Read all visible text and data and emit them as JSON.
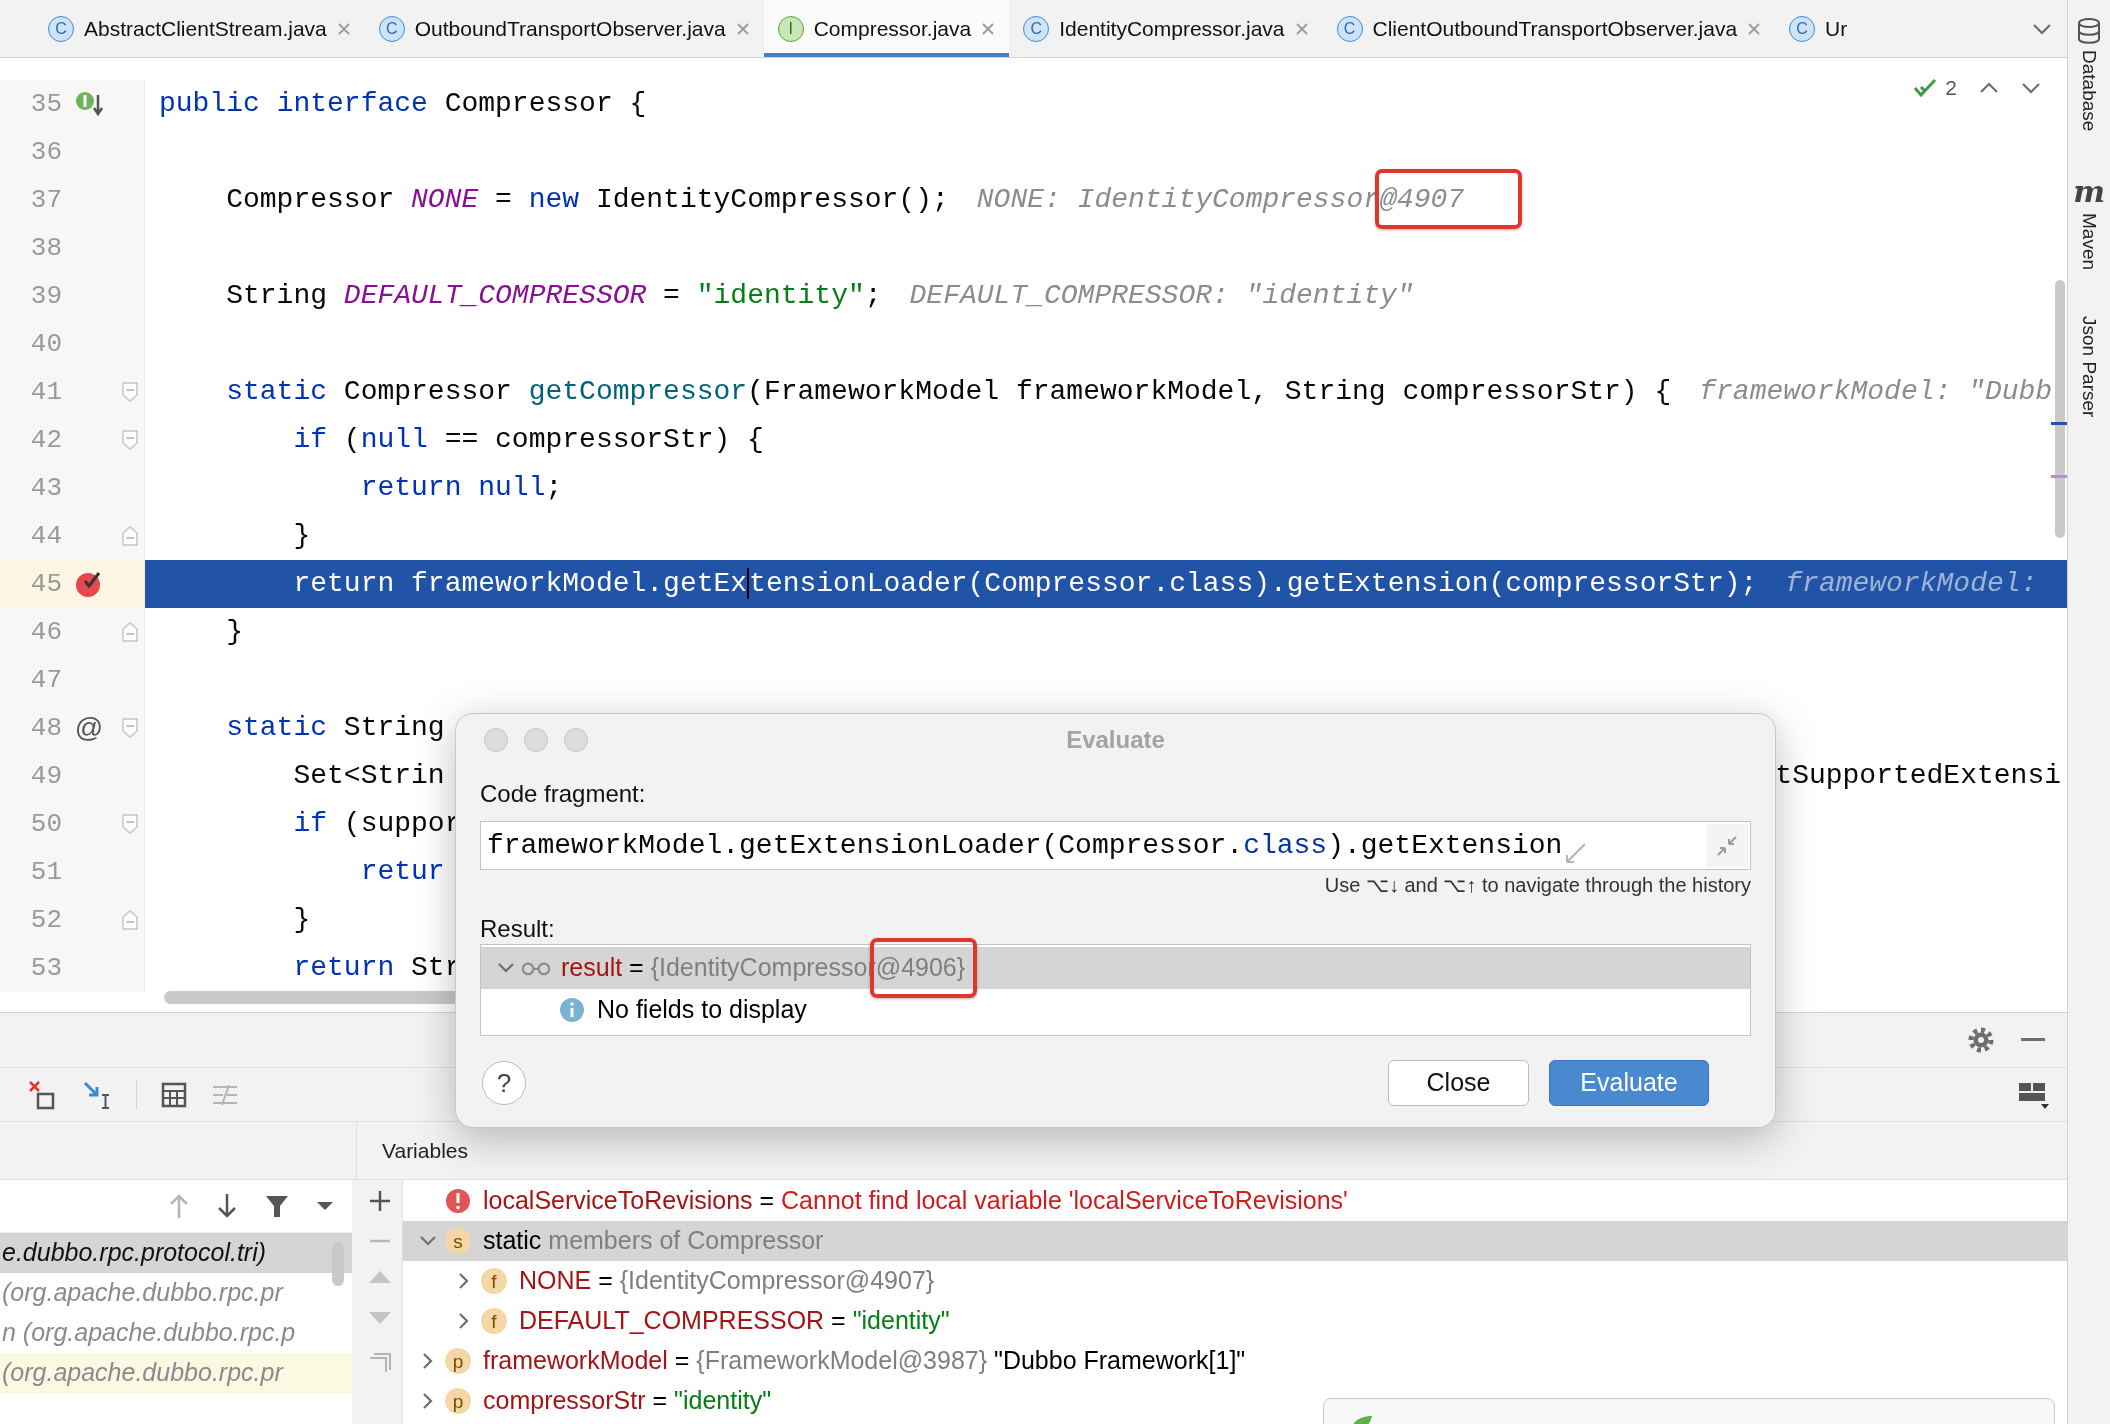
{
  "tabs": [
    {
      "icon": "C",
      "kind": "class",
      "label": "AbstractClientStream.java",
      "closable": true,
      "selected": false
    },
    {
      "icon": "C",
      "kind": "class",
      "label": "OutboundTransportObserver.java",
      "closable": true,
      "selected": false
    },
    {
      "icon": "I",
      "kind": "interface",
      "label": "Compressor.java",
      "closable": true,
      "selected": true
    },
    {
      "icon": "C",
      "kind": "class",
      "label": "IdentityCompressor.java",
      "closable": true,
      "selected": false
    },
    {
      "icon": "C",
      "kind": "class",
      "label": "ClientOutboundTransportObserver.java",
      "closable": true,
      "selected": false
    },
    {
      "icon": "C",
      "kind": "class",
      "label": "Ur",
      "closable": false,
      "selected": false
    }
  ],
  "inspection": {
    "count": "2"
  },
  "editor": {
    "lines": [
      {
        "number": "35",
        "highlighted": false,
        "gutter": {
          "kind": "implemented"
        },
        "tokens": [
          {
            "text": "public",
            "kind": "keyword"
          },
          {
            "text": " interface",
            "kind": "keyword"
          },
          {
            "text": " Compressor {",
            "kind": "plain"
          }
        ]
      },
      {
        "number": "36",
        "highlighted": false
      },
      {
        "number": "37",
        "highlighted": false,
        "tokens": [
          {
            "text": "    Compressor ",
            "kind": "plain"
          },
          {
            "text": "NONE",
            "kind": "field"
          },
          {
            "text": " = ",
            "kind": "plain"
          },
          {
            "text": "new",
            "kind": "keyword"
          },
          {
            "text": " IdentityCompressor();",
            "kind": "plain"
          },
          {
            "text": "NONE: IdentityCompressor",
            "kind": "hint"
          },
          {
            "text": "@4907",
            "kind": "hint",
            "annotated": true
          }
        ]
      },
      {
        "number": "38",
        "highlighted": false
      },
      {
        "number": "39",
        "highlighted": false,
        "tokens": [
          {
            "text": "    String ",
            "kind": "plain"
          },
          {
            "text": "DEFAULT_COMPRESSOR",
            "kind": "field"
          },
          {
            "text": " = ",
            "kind": "plain"
          },
          {
            "text": "\"identity\"",
            "kind": "string"
          },
          {
            "text": ";",
            "kind": "plain"
          },
          {
            "text": "DEFAULT_COMPRESSOR: \"identity\"",
            "kind": "hint"
          }
        ]
      },
      {
        "number": "40",
        "highlighted": false
      },
      {
        "number": "41",
        "highlighted": false,
        "fold": {
          "kind": "start"
        },
        "tokens": [
          {
            "text": "    static",
            "kind": "keyword"
          },
          {
            "text": " Compressor ",
            "kind": "plain"
          },
          {
            "text": "getCompressor",
            "kind": "method"
          },
          {
            "text": "(FrameworkModel frameworkModel, String compressorStr) {",
            "kind": "plain"
          },
          {
            "text": "frameworkModel: \"Dubb",
            "kind": "hint"
          }
        ]
      },
      {
        "number": "42",
        "highlighted": false,
        "fold": {
          "kind": "start"
        },
        "tokens": [
          {
            "text": "        if",
            "kind": "keyword"
          },
          {
            "text": " (",
            "kind": "plain"
          },
          {
            "text": "null",
            "kind": "keyword"
          },
          {
            "text": " == compressorStr) {",
            "kind": "plain"
          }
        ]
      },
      {
        "number": "43",
        "highlighted": false,
        "tokens": [
          {
            "text": "            return",
            "kind": "keyword"
          },
          {
            "text": " null",
            "kind": "keyword"
          },
          {
            "text": ";",
            "kind": "plain"
          }
        ]
      },
      {
        "number": "44",
        "highlighted": false,
        "fold": {
          "kind": "end"
        },
        "tokens": [
          {
            "text": "        }",
            "kind": "plain"
          }
        ]
      },
      {
        "number": "45",
        "highlighted": true,
        "gutter": {
          "kind": "breakpoint"
        },
        "tokens": [
          {
            "text": "        return",
            "kind": "keyword"
          },
          {
            "text": " frameworkModel.getEx",
            "kind": "plain",
            "caret": true
          },
          {
            "text": "tensionLoader(Compressor.",
            "kind": "plain"
          },
          {
            "text": "class",
            "kind": "keyword"
          },
          {
            "text": ").getExtension(compressorStr);",
            "kind": "plain"
          },
          {
            "text": "frameworkModel:",
            "kind": "hint"
          }
        ]
      },
      {
        "number": "46",
        "highlighted": false,
        "fold": {
          "kind": "end"
        },
        "tokens": [
          {
            "text": "    }",
            "kind": "plain"
          }
        ]
      },
      {
        "number": "47",
        "highlighted": false
      },
      {
        "number": "48",
        "highlighted": false,
        "gutter": {
          "kind": "symbol",
          "text": "@"
        },
        "fold": {
          "kind": "start"
        },
        "tokens": [
          {
            "text": "    static",
            "kind": "keyword"
          },
          {
            "text": " String",
            "kind": "plain"
          }
        ]
      },
      {
        "number": "49",
        "highlighted": false,
        "tokens": [
          {
            "text": "        Set<Strin",
            "kind": "plain"
          },
          {
            "text": "tSupportedExtensi",
            "kind": "continuation"
          }
        ]
      },
      {
        "number": "50",
        "highlighted": false,
        "fold": {
          "kind": "start"
        },
        "tokens": [
          {
            "text": "        if",
            "kind": "keyword"
          },
          {
            "text": " (suppor",
            "kind": "plain"
          }
        ]
      },
      {
        "number": "51",
        "highlighted": false,
        "tokens": [
          {
            "text": "            retur",
            "kind": "keyword"
          }
        ]
      },
      {
        "number": "52",
        "highlighted": false,
        "fold": {
          "kind": "end"
        },
        "tokens": [
          {
            "text": "        }",
            "kind": "plain"
          }
        ]
      },
      {
        "number": "53",
        "highlighted": false,
        "tokens": [
          {
            "text": "        return",
            "kind": "keyword"
          },
          {
            "text": " Str",
            "kind": "plain"
          }
        ]
      }
    ]
  },
  "sidebar": [
    {
      "label": "Database",
      "kind": "database"
    },
    {
      "label": "Maven",
      "kind": "maven",
      "icon_text": "m"
    },
    {
      "label": "Json Parser",
      "kind": "plain"
    }
  ],
  "debug_panel": {
    "variables_title": "Variables",
    "frames": [
      {
        "text": "e.dubbo.rpc.protocol.tri)",
        "selected": true,
        "library": false
      },
      {
        "text": "(org.apache.dubbo.rpc.pr",
        "selected": false,
        "library": false
      },
      {
        "text": "n (org.apache.dubbo.rpc.p",
        "selected": false,
        "library": false
      },
      {
        "text": "(org.apache.dubbo.rpc.pr",
        "selected": false,
        "library": true
      }
    ],
    "variables": [
      {
        "kind": "error",
        "selected": false,
        "parts": [
          {
            "text": "localServiceToRevisions",
            "kind": "name"
          },
          {
            "text": " = ",
            "kind": "plain"
          },
          {
            "text": "Cannot find local variable 'localServiceToRevisions'",
            "kind": "error"
          }
        ]
      },
      {
        "kind": "static",
        "icon_text": "s",
        "expanded": true,
        "selected": true,
        "parts": [
          {
            "text": "static",
            "kind": "plain"
          },
          {
            "text": " members of Compressor",
            "kind": "muted"
          }
        ],
        "children": [
          {
            "kind": "field",
            "icon_text": "f",
            "expanded": false,
            "selected": false,
            "parts": [
              {
                "text": "NONE",
                "kind": "name"
              },
              {
                "text": " = ",
                "kind": "plain"
              },
              {
                "text": "{IdentityCompressor@4907}",
                "kind": "muted"
              }
            ]
          },
          {
            "kind": "field",
            "icon_text": "f",
            "expanded": false,
            "selected": false,
            "parts": [
              {
                "text": "DEFAULT_COMPRESSOR",
                "kind": "name"
              },
              {
                "text": " = ",
                "kind": "plain"
              },
              {
                "text": "\"identity\"",
                "kind": "string"
              }
            ]
          }
        ]
      },
      {
        "kind": "param",
        "icon_text": "p",
        "expanded": false,
        "selected": false,
        "parts": [
          {
            "text": "frameworkModel",
            "kind": "name"
          },
          {
            "text": " = ",
            "kind": "plain"
          },
          {
            "text": "{FrameworkModel@3987}",
            "kind": "muted"
          },
          {
            "text": " \"Dubbo Framework[1]\"",
            "kind": "plain"
          }
        ]
      },
      {
        "kind": "param",
        "icon_text": "p",
        "expanded": false,
        "selected": false,
        "parts": [
          {
            "text": "compressorStr",
            "kind": "name"
          },
          {
            "text": " = ",
            "kind": "plain"
          },
          {
            "text": "\"identity\"",
            "kind": "string"
          }
        ]
      }
    ]
  },
  "evaluate_dialog": {
    "title": "Evaluate",
    "code_label": "Code fragment:",
    "code": [
      {
        "text": "frameworkModel.getExtensionLoader(Compressor.",
        "kind": "plain"
      },
      {
        "text": "class",
        "kind": "keyword"
      },
      {
        "text": ").getExtension",
        "kind": "plain"
      }
    ],
    "history_hint": "Use ⌥↓ and ⌥↑ to navigate through the history",
    "result_label": "Result:",
    "result": [
      {
        "kind": "watch",
        "expanded": true,
        "selected": true,
        "parts": [
          {
            "text": "result",
            "kind": "name"
          },
          {
            "text": " = ",
            "kind": "plain"
          },
          {
            "text": "{IdentityCompressor",
            "kind": "muted"
          },
          {
            "text": "@4906}",
            "kind": "muted",
            "annotated": true
          }
        ],
        "children": [
          {
            "kind": "info",
            "selected": false,
            "parts": [
              {
                "text": "No fields to display",
                "kind": "plain"
              }
            ]
          }
        ]
      }
    ],
    "help": "?",
    "buttons": [
      {
        "label": "Close",
        "primary": false
      },
      {
        "label": "Evaluate",
        "primary": true
      }
    ]
  }
}
